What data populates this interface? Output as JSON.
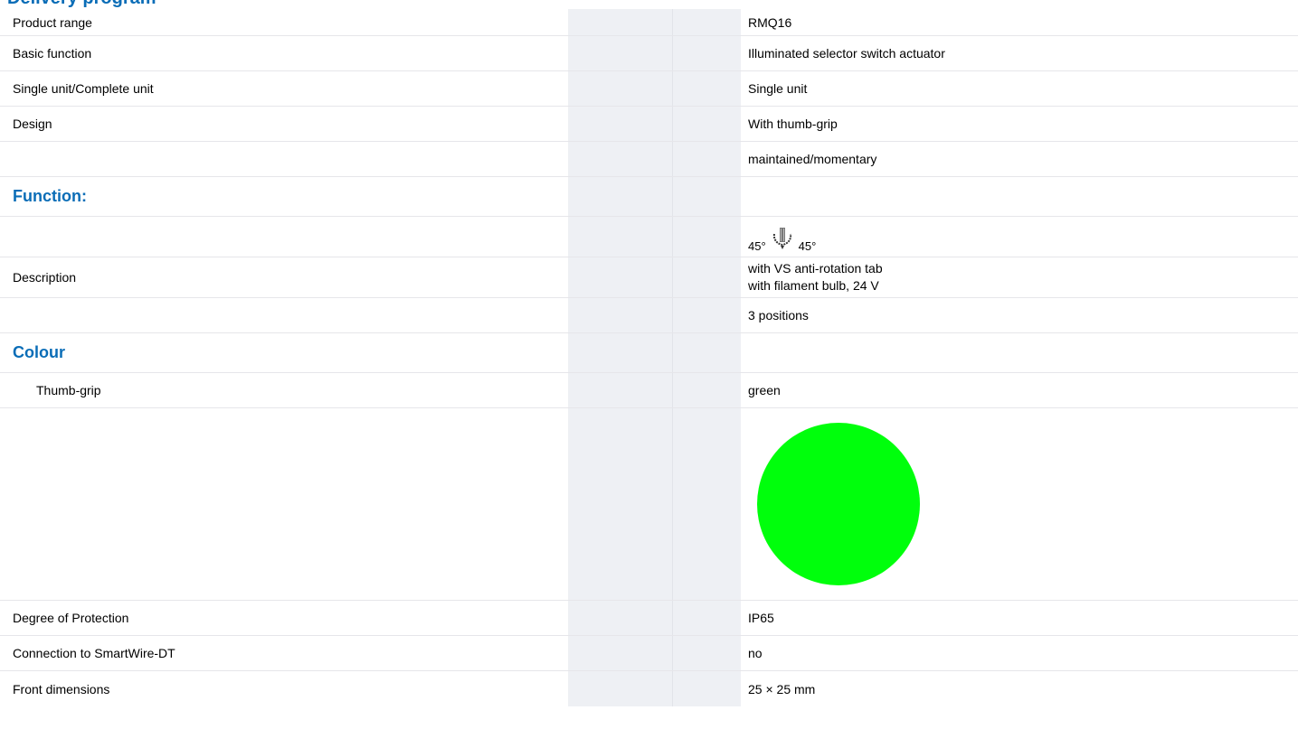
{
  "header": {
    "title": "Delivery program"
  },
  "rows": [
    {
      "label": "Product range",
      "value": "RMQ16"
    },
    {
      "label": "Basic function",
      "value": "Illuminated selector switch actuator"
    },
    {
      "label": "Single unit/Complete unit",
      "value": "Single unit"
    },
    {
      "label": "Design",
      "value": "With thumb-grip"
    },
    {
      "label": "",
      "value": "maintained/momentary"
    },
    {
      "section": "Function:"
    },
    {
      "label": "",
      "angle_left": "45°",
      "angle_right": "45°",
      "icon": "selector-switch-icon"
    },
    {
      "label": "Description",
      "value_line1": "with VS anti-rotation tab",
      "value_line2": "with filament bulb, 24 V"
    },
    {
      "label": "",
      "value": "3 positions"
    },
    {
      "section": "Colour"
    },
    {
      "label": "Thumb-grip",
      "value": "green"
    },
    {
      "swatch_color": "#00ff0c"
    },
    {
      "label": "Degree of Protection",
      "value": "IP65"
    },
    {
      "label": "Connection to SmartWire-DT",
      "value": "no"
    },
    {
      "label": "Front dimensions",
      "value": "25 × 25 mm"
    }
  ]
}
